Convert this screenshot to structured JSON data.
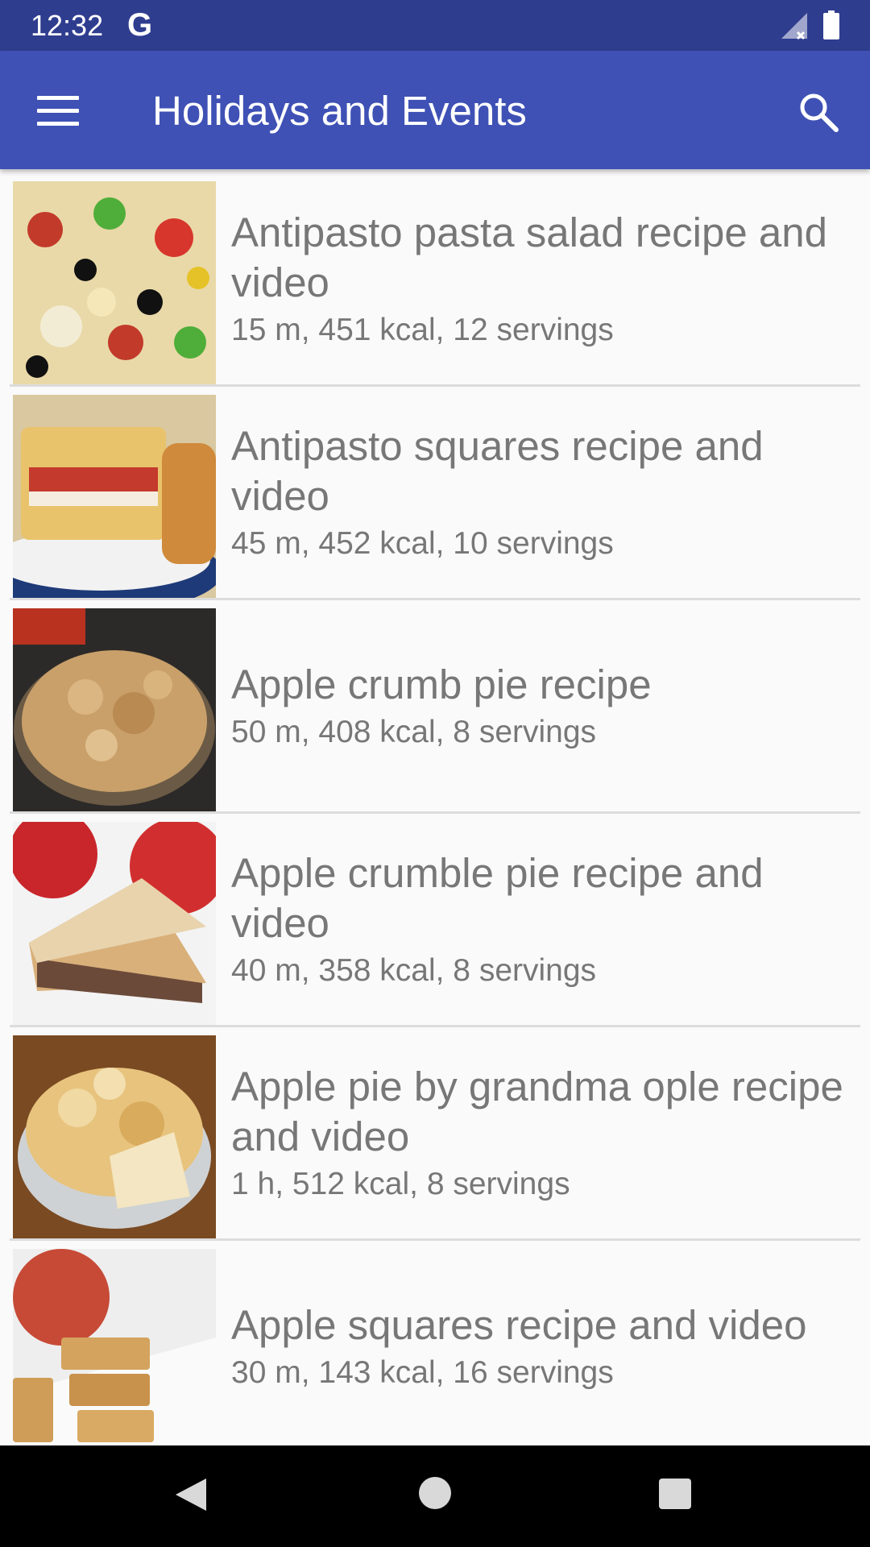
{
  "status_bar": {
    "time": "12:32",
    "google_glyph": "G",
    "icons": [
      "signal-icon",
      "battery-icon"
    ]
  },
  "app_bar": {
    "title": "Holidays and Events",
    "menu_icon": "menu-icon",
    "search_icon": "search-icon"
  },
  "recipes": [
    {
      "title": "Antipasto pasta salad recipe and video",
      "meta": "15 m, 451 kcal, 12 servings",
      "image": "antipasto-pasta-salad"
    },
    {
      "title": "Antipasto squares recipe and video",
      "meta": "45 m, 452 kcal, 10 servings",
      "image": "antipasto-squares"
    },
    {
      "title": "Apple crumb pie recipe",
      "meta": "50 m, 408 kcal, 8 servings",
      "image": "apple-crumb-pie"
    },
    {
      "title": "Apple crumble pie recipe and video",
      "meta": "40 m, 358 kcal, 8 servings",
      "image": "apple-crumble-pie"
    },
    {
      "title": "Apple pie by grandma ople recipe and video",
      "meta": "1 h, 512 kcal, 8 servings",
      "image": "apple-pie-grandma-ople"
    },
    {
      "title": "Apple squares recipe and video",
      "meta": "30 m, 143 kcal, 16 servings",
      "image": "apple-squares"
    }
  ],
  "nav_bar": {
    "icons": [
      "back-icon",
      "home-icon",
      "recents-icon"
    ]
  },
  "colors": {
    "status_bar": "#2f3d8f",
    "app_bar": "#3f51b5",
    "text": "#777777",
    "background": "#fafafa"
  }
}
